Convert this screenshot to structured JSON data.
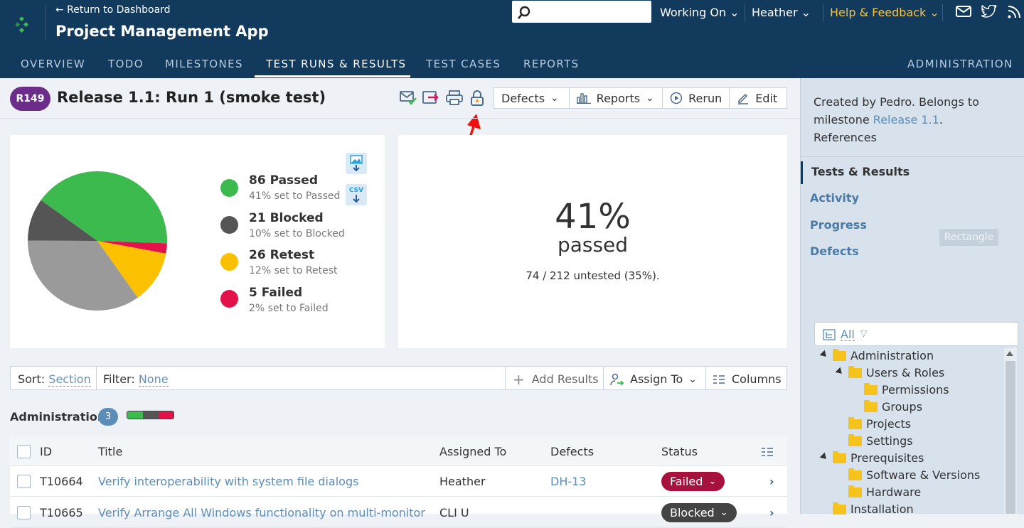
{
  "header": {
    "back_link": "← Return to Dashboard",
    "app_title": "Project Management App",
    "search_value": "",
    "working_on": "Working On",
    "user": "Heather",
    "help": "Help & Feedback"
  },
  "nav": {
    "tabs": [
      "OVERVIEW",
      "TODO",
      "MILESTONES",
      "TEST RUNS & RESULTS",
      "TEST CASES",
      "REPORTS"
    ],
    "active_tab": "TEST RUNS & RESULTS",
    "admin": "ADMINISTRATION"
  },
  "run": {
    "badge": "R149",
    "title": "Release 1.1: Run 1 (smoke test)"
  },
  "toolbar": {
    "defects": "Defects",
    "reports": "Reports",
    "rerun": "Rerun",
    "edit": "Edit"
  },
  "chart_data": {
    "type": "pie",
    "slices": [
      {
        "label": "86 Passed",
        "value": 86,
        "sublabel": "41% set to Passed",
        "color": "#3dba4e"
      },
      {
        "label": "21 Blocked",
        "value": 21,
        "sublabel": "10% set to Blocked",
        "color": "#555555"
      },
      {
        "label": "26 Retest",
        "value": 26,
        "sublabel": "12% set to Retest",
        "color": "#fbc000"
      },
      {
        "label": "5 Failed",
        "value": 5,
        "sublabel": "2% set to Failed",
        "color": "#e4124b"
      },
      {
        "label": "Untested",
        "value": 74,
        "color": "#9a9a9a"
      }
    ]
  },
  "downloads": {
    "csv": "CSV"
  },
  "summary": {
    "percent": "41%",
    "label": "passed",
    "untested": "74 / 212 untested (35%)."
  },
  "filterbar": {
    "sort_label": "Sort:",
    "sort_value": "Section",
    "filter_label": "Filter:",
    "filter_value": "None",
    "add_results": "Add Results",
    "assign_to": "Assign To",
    "columns": "Columns"
  },
  "section": {
    "title": "Administration",
    "count": "3",
    "bar_fractions": {
      "passed": 0.34,
      "blocked": 0.33,
      "failed": 0.33
    }
  },
  "table": {
    "headers": {
      "id": "ID",
      "title": "Title",
      "assigned": "Assigned To",
      "defects": "Defects",
      "status": "Status"
    },
    "rows": [
      {
        "id": "T10664",
        "title": "Verify interoperability with system file dialogs",
        "assigned": "Heather",
        "defects": "DH-13",
        "status": "Failed",
        "status_color": "#a6113d"
      },
      {
        "id": "T10665",
        "title": "Verify Arrange All Windows functionality on multi-monitor",
        "assigned": "CLI U",
        "defects": "",
        "status": "Blocked",
        "status_color": "#444444"
      }
    ]
  },
  "sidebar": {
    "desc_prefix": "Created by Pedro. Belongs to milestone",
    "milestone_link": "Release 1.1",
    "desc_suffix": ".",
    "references": "References",
    "items": [
      "Tests & Results",
      "Activity",
      "Progress",
      "Defects"
    ],
    "tooltip": "Rectangle",
    "tree_filter": "All",
    "tree": [
      {
        "label": "Administration",
        "level": 0,
        "expanded": true
      },
      {
        "label": "Users & Roles",
        "level": 1,
        "expanded": true
      },
      {
        "label": "Permissions",
        "level": 2
      },
      {
        "label": "Groups",
        "level": 2
      },
      {
        "label": "Projects",
        "level": 1
      },
      {
        "label": "Settings",
        "level": 1
      },
      {
        "label": "Prerequisites",
        "level": 0,
        "expanded": true
      },
      {
        "label": "Software & Versions",
        "level": 1
      },
      {
        "label": "Hardware",
        "level": 1
      },
      {
        "label": "Installation",
        "level": 0
      }
    ]
  }
}
